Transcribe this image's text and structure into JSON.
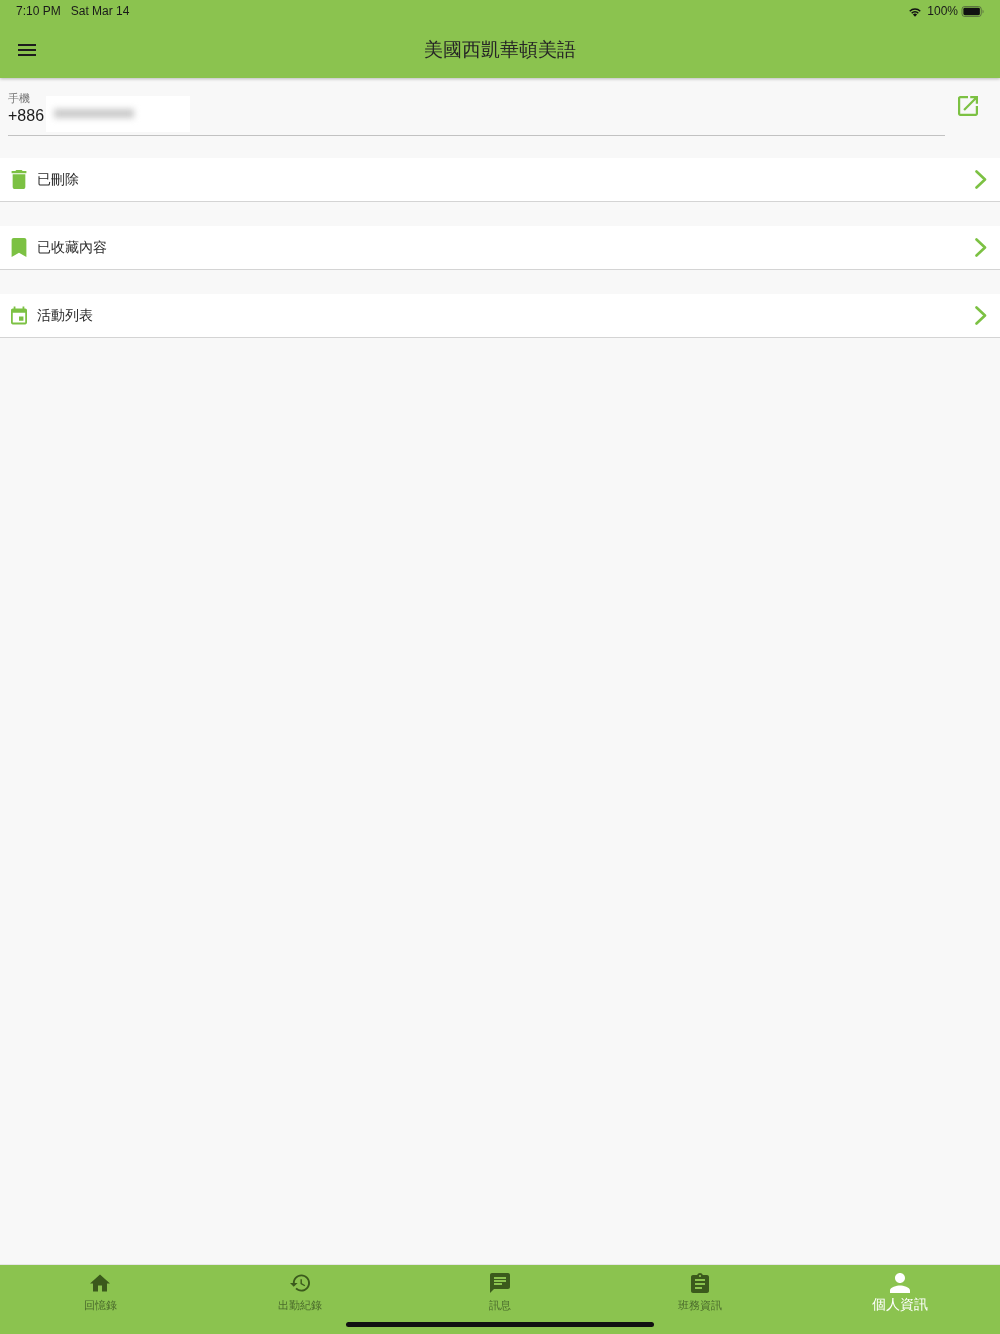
{
  "status_bar": {
    "time": "7:10 PM",
    "date": "Sat Mar 14",
    "battery": "100%"
  },
  "app_bar": {
    "title": "美國西凱華頓美語"
  },
  "phone_field": {
    "label": "手機",
    "value": "+886"
  },
  "menu_items": [
    {
      "kind": "trash",
      "label": "已刪除"
    },
    {
      "kind": "bookmark",
      "label": "已收藏內容"
    },
    {
      "kind": "calendar",
      "label": "活動列表"
    }
  ],
  "bottom_nav": [
    {
      "kind": "home",
      "label": "回憶錄",
      "selected": false
    },
    {
      "kind": "history",
      "label": "出勤紀錄",
      "selected": false
    },
    {
      "kind": "chat",
      "label": "訊息",
      "selected": false
    },
    {
      "kind": "clipboard",
      "label": "班務資訊",
      "selected": false
    },
    {
      "kind": "person",
      "label": "個人資訊",
      "selected": true
    }
  ]
}
